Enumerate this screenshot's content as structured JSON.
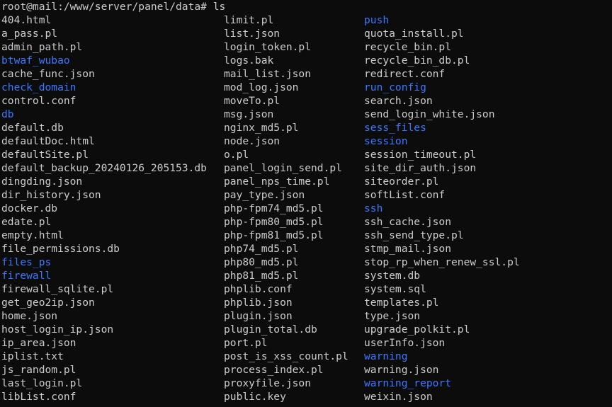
{
  "terminal": {
    "prompt": "root@mail:/www/server/panel/data#",
    "command": "ls",
    "colors": {
      "background": "#0c0c0c",
      "text": "#cccccc",
      "directory": "#3b78ff"
    },
    "columns": [
      [
        {
          "name": "404.html",
          "dir": false
        },
        {
          "name": "a_pass.pl",
          "dir": false
        },
        {
          "name": "admin_path.pl",
          "dir": false
        },
        {
          "name": "btwaf_wubao",
          "dir": true
        },
        {
          "name": "cache_func.json",
          "dir": false
        },
        {
          "name": "check_domain",
          "dir": true
        },
        {
          "name": "control.conf",
          "dir": false
        },
        {
          "name": "db",
          "dir": true
        },
        {
          "name": "default.db",
          "dir": false
        },
        {
          "name": "defaultDoc.html",
          "dir": false
        },
        {
          "name": "defaultSite.pl",
          "dir": false
        },
        {
          "name": "default_backup_20240126_205153.db",
          "dir": false
        },
        {
          "name": "dingding.json",
          "dir": false
        },
        {
          "name": "dir_history.json",
          "dir": false
        },
        {
          "name": "docker.db",
          "dir": false
        },
        {
          "name": "edate.pl",
          "dir": false
        },
        {
          "name": "empty.html",
          "dir": false
        },
        {
          "name": "file_permissions.db",
          "dir": false
        },
        {
          "name": "files_ps",
          "dir": true
        },
        {
          "name": "firewall",
          "dir": true
        },
        {
          "name": "firewall_sqlite.pl",
          "dir": false
        },
        {
          "name": "get_geo2ip.json",
          "dir": false
        },
        {
          "name": "home.json",
          "dir": false
        },
        {
          "name": "host_login_ip.json",
          "dir": false
        },
        {
          "name": "ip_area.json",
          "dir": false
        },
        {
          "name": "iplist.txt",
          "dir": false
        },
        {
          "name": "js_random.pl",
          "dir": false
        },
        {
          "name": "last_login.pl",
          "dir": false
        },
        {
          "name": "libList.conf",
          "dir": false
        }
      ],
      [
        {
          "name": "limit.pl",
          "dir": false
        },
        {
          "name": "list.json",
          "dir": false
        },
        {
          "name": "login_token.pl",
          "dir": false
        },
        {
          "name": "logs.bak",
          "dir": false
        },
        {
          "name": "mail_list.json",
          "dir": false
        },
        {
          "name": "mod_log.json",
          "dir": false
        },
        {
          "name": "moveTo.pl",
          "dir": false
        },
        {
          "name": "msg.json",
          "dir": false
        },
        {
          "name": "nginx_md5.pl",
          "dir": false
        },
        {
          "name": "node.json",
          "dir": false
        },
        {
          "name": "o.pl",
          "dir": false
        },
        {
          "name": "panel_login_send.pl",
          "dir": false
        },
        {
          "name": "panel_nps_time.pl",
          "dir": false
        },
        {
          "name": "pay_type.json",
          "dir": false
        },
        {
          "name": "php-fpm74_md5.pl",
          "dir": false
        },
        {
          "name": "php-fpm80_md5.pl",
          "dir": false
        },
        {
          "name": "php-fpm81_md5.pl",
          "dir": false
        },
        {
          "name": "php74_md5.pl",
          "dir": false
        },
        {
          "name": "php80_md5.pl",
          "dir": false
        },
        {
          "name": "php81_md5.pl",
          "dir": false
        },
        {
          "name": "phplib.conf",
          "dir": false
        },
        {
          "name": "phplib.json",
          "dir": false
        },
        {
          "name": "plugin.json",
          "dir": false
        },
        {
          "name": "plugin_total.db",
          "dir": false
        },
        {
          "name": "port.pl",
          "dir": false
        },
        {
          "name": "post_is_xss_count.pl",
          "dir": false
        },
        {
          "name": "process_index.pl",
          "dir": false
        },
        {
          "name": "proxyfile.json",
          "dir": false
        },
        {
          "name": "public.key",
          "dir": false
        }
      ],
      [
        {
          "name": "push",
          "dir": true
        },
        {
          "name": "quota_install.pl",
          "dir": false
        },
        {
          "name": "recycle_bin.pl",
          "dir": false
        },
        {
          "name": "recycle_bin_db.pl",
          "dir": false
        },
        {
          "name": "redirect.conf",
          "dir": false
        },
        {
          "name": "run_config",
          "dir": true
        },
        {
          "name": "search.json",
          "dir": false
        },
        {
          "name": "send_login_white.json",
          "dir": false
        },
        {
          "name": "sess_files",
          "dir": true
        },
        {
          "name": "session",
          "dir": true
        },
        {
          "name": "session_timeout.pl",
          "dir": false
        },
        {
          "name": "site_dir_auth.json",
          "dir": false
        },
        {
          "name": "siteorder.pl",
          "dir": false
        },
        {
          "name": "softList.conf",
          "dir": false
        },
        {
          "name": "ssh",
          "dir": true
        },
        {
          "name": "ssh_cache.json",
          "dir": false
        },
        {
          "name": "ssh_send_type.pl",
          "dir": false
        },
        {
          "name": "stmp_mail.json",
          "dir": false
        },
        {
          "name": "stop_rp_when_renew_ssl.pl",
          "dir": false
        },
        {
          "name": "system.db",
          "dir": false
        },
        {
          "name": "system.sql",
          "dir": false
        },
        {
          "name": "templates.pl",
          "dir": false
        },
        {
          "name": "type.json",
          "dir": false
        },
        {
          "name": "upgrade_polkit.pl",
          "dir": false
        },
        {
          "name": "userInfo.json",
          "dir": false
        },
        {
          "name": "warning",
          "dir": true
        },
        {
          "name": "warning.json",
          "dir": false
        },
        {
          "name": "warning_report",
          "dir": true
        },
        {
          "name": "weixin.json",
          "dir": false
        }
      ]
    ]
  }
}
